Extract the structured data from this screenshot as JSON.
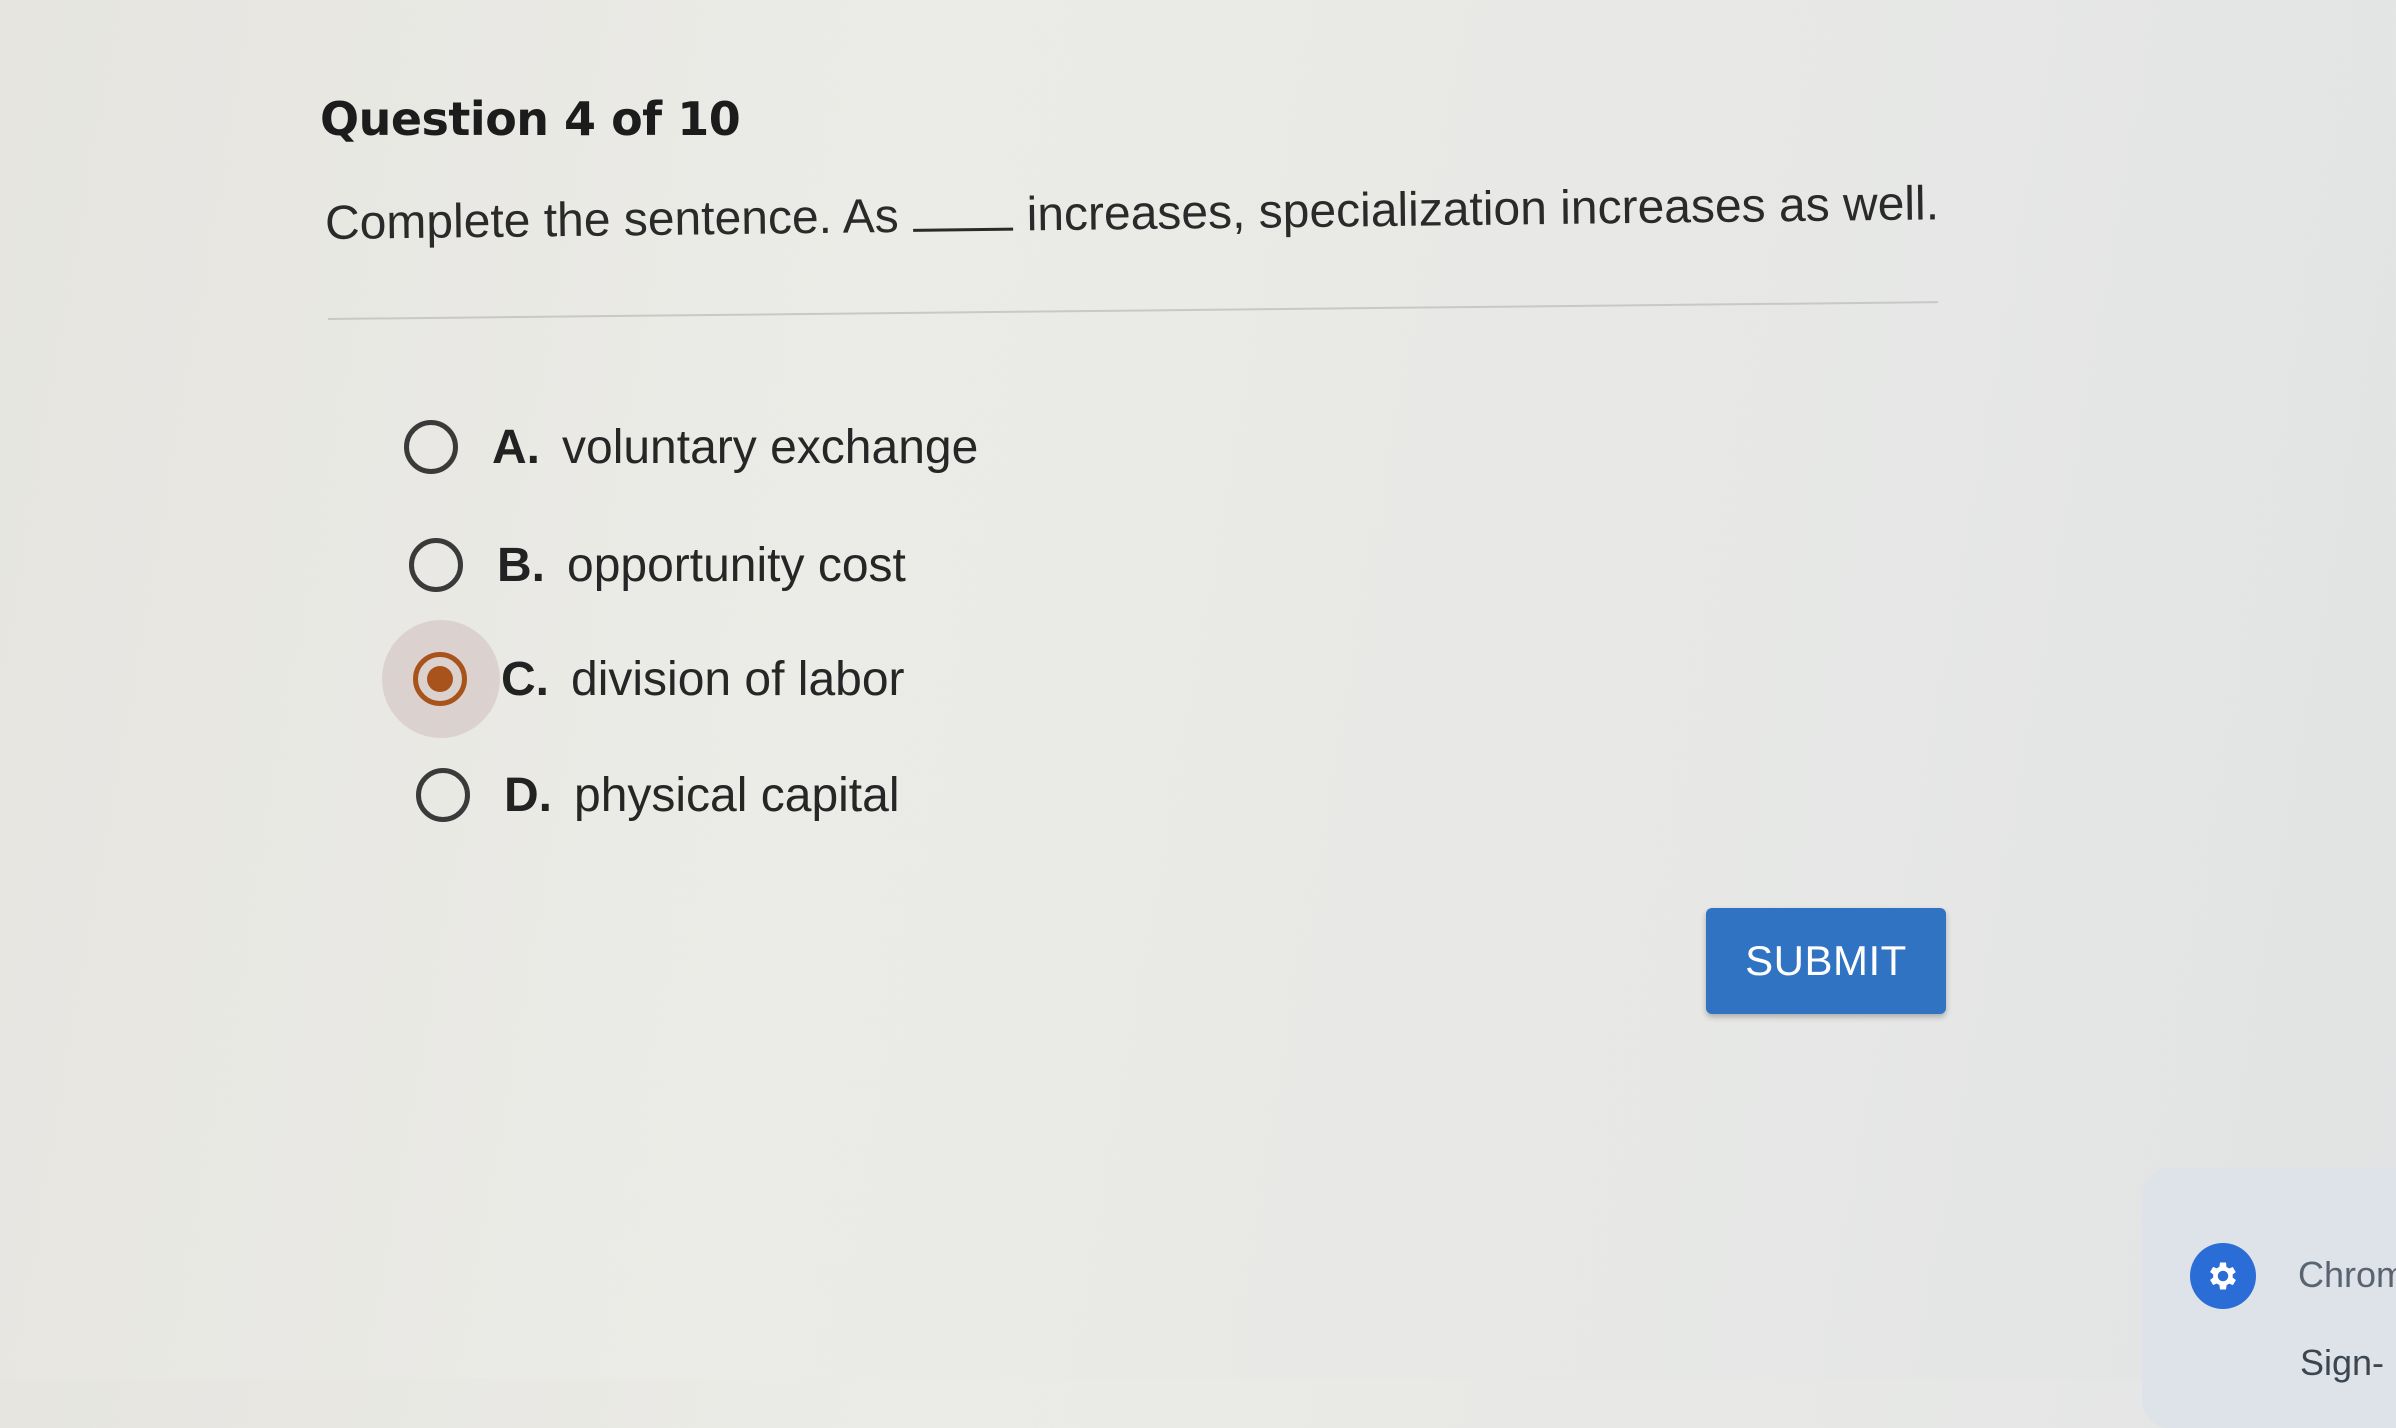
{
  "question": {
    "title": "Question 4 of 10",
    "prompt_before": "Complete the sentence. As",
    "prompt_after": "increases, specialization increases as well."
  },
  "options": [
    {
      "letter": "A.",
      "text": "voluntary exchange",
      "selected": false
    },
    {
      "letter": "B.",
      "text": "opportunity cost",
      "selected": false
    },
    {
      "letter": "C.",
      "text": "division of labor",
      "selected": true
    },
    {
      "letter": "D.",
      "text": "physical capital",
      "selected": false
    }
  ],
  "submit": {
    "label": "SUBMIT"
  },
  "notification": {
    "icon": "settings-gear-icon",
    "title": "Chrom",
    "subtitle": "Sign-"
  },
  "colors": {
    "accent": "#2f73c2",
    "selected_radio": "#a8521c"
  }
}
